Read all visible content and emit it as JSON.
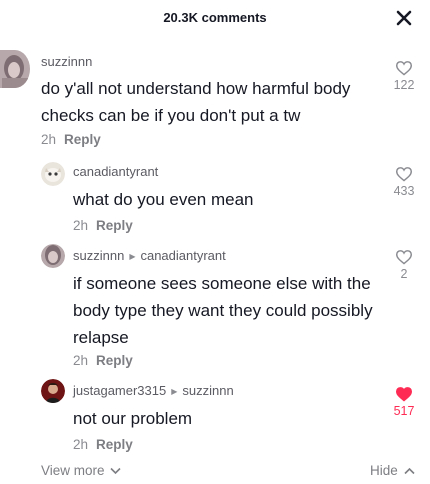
{
  "header": {
    "title": "20.3K comments",
    "close_icon": "close-icon"
  },
  "comments": [
    {
      "username": "suzzinnn",
      "reply_to": "",
      "text": "do y'all not understand how harmful body checks can be if you don't put a tw",
      "time": "2h",
      "reply_label": "Reply",
      "likes": "122",
      "liked": false
    },
    {
      "username": "canadiantyrant",
      "reply_to": "",
      "text": "what do you even mean",
      "time": "2h",
      "reply_label": "Reply",
      "likes": "433",
      "liked": false
    },
    {
      "username": "suzzinnn",
      "reply_to": "canadiantyrant",
      "text": "if someone sees someone else with the body type they want they could possibly relapse",
      "time": "2h",
      "reply_label": "Reply",
      "likes": "2",
      "liked": false
    },
    {
      "username": "justagamer3315",
      "reply_to": "suzzinnn",
      "text": "not our problem",
      "time": "2h",
      "reply_label": "Reply",
      "likes": "517",
      "liked": true
    }
  ],
  "footer": {
    "view_more": "View more",
    "hide": "Hide"
  },
  "colors": {
    "liked": "#fe2c55",
    "muted": "#8a8b91",
    "text": "#161823"
  }
}
